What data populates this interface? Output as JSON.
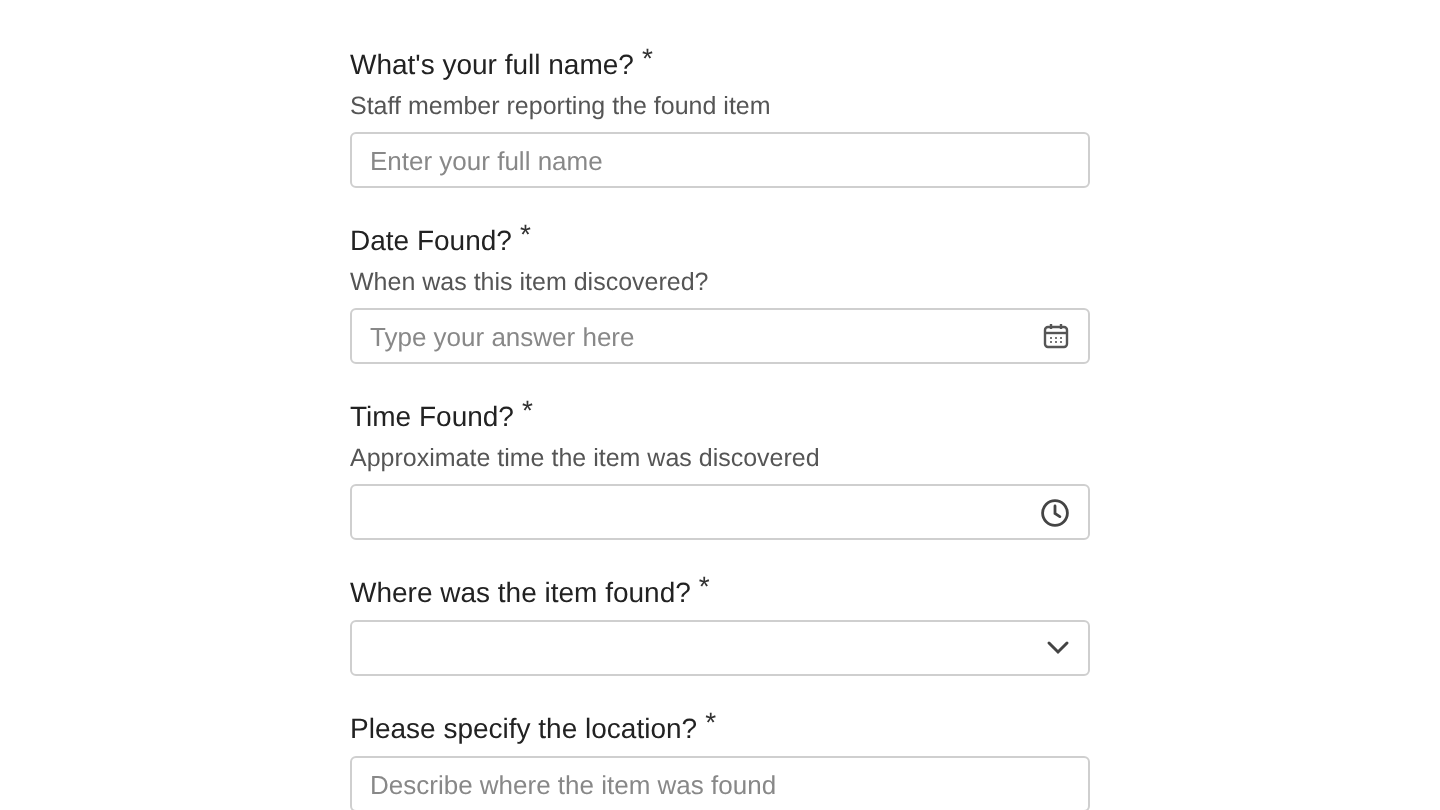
{
  "fields": [
    {
      "kind": "text",
      "label": "What's your full name?",
      "mark": "*",
      "hint": "Staff member reporting the found item",
      "placeholder": "Enter your full name"
    },
    {
      "kind": "date",
      "label": "Date Found?",
      "mark": "*",
      "hint": "When was this item discovered?",
      "placeholder": "Type your answer here"
    },
    {
      "kind": "time",
      "label": "Time Found?",
      "mark": "*",
      "hint": "Approximate time the item was discovered"
    },
    {
      "kind": "select",
      "label": "Where was the item found?",
      "mark": "*"
    },
    {
      "kind": "text",
      "label": "Please specify the location?",
      "mark": "*",
      "placeholder": "Describe where the item was found"
    }
  ]
}
